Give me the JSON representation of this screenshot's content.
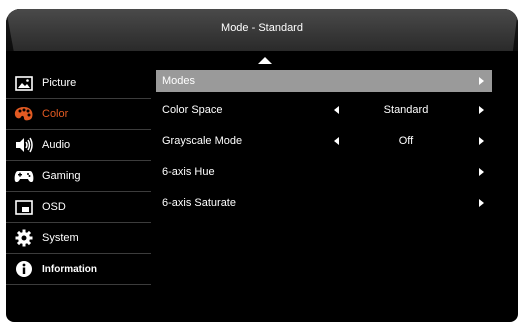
{
  "header": {
    "title": "Mode - Standard"
  },
  "sidebar": {
    "items": [
      {
        "label": "Picture",
        "icon": "picture-icon"
      },
      {
        "label": "Color",
        "icon": "palette-icon",
        "active": true
      },
      {
        "label": "Audio",
        "icon": "speaker-icon"
      },
      {
        "label": "Gaming",
        "icon": "gamepad-icon"
      },
      {
        "label": "OSD",
        "icon": "osd-window-icon"
      },
      {
        "label": "System",
        "icon": "gear-icon"
      },
      {
        "label": "Information",
        "icon": "info-icon"
      }
    ]
  },
  "menu": {
    "rows": [
      {
        "label": "Modes",
        "value": ""
      },
      {
        "label": "Color Space",
        "value": "Standard"
      },
      {
        "label": "Grayscale Mode",
        "value": "Off"
      },
      {
        "label": "6-axis Hue",
        "value": ""
      },
      {
        "label": "6-axis Saturate",
        "value": ""
      }
    ]
  },
  "colors": {
    "accent": "#e25a22",
    "highlight": "#9a9a9a",
    "background": "#000000"
  }
}
